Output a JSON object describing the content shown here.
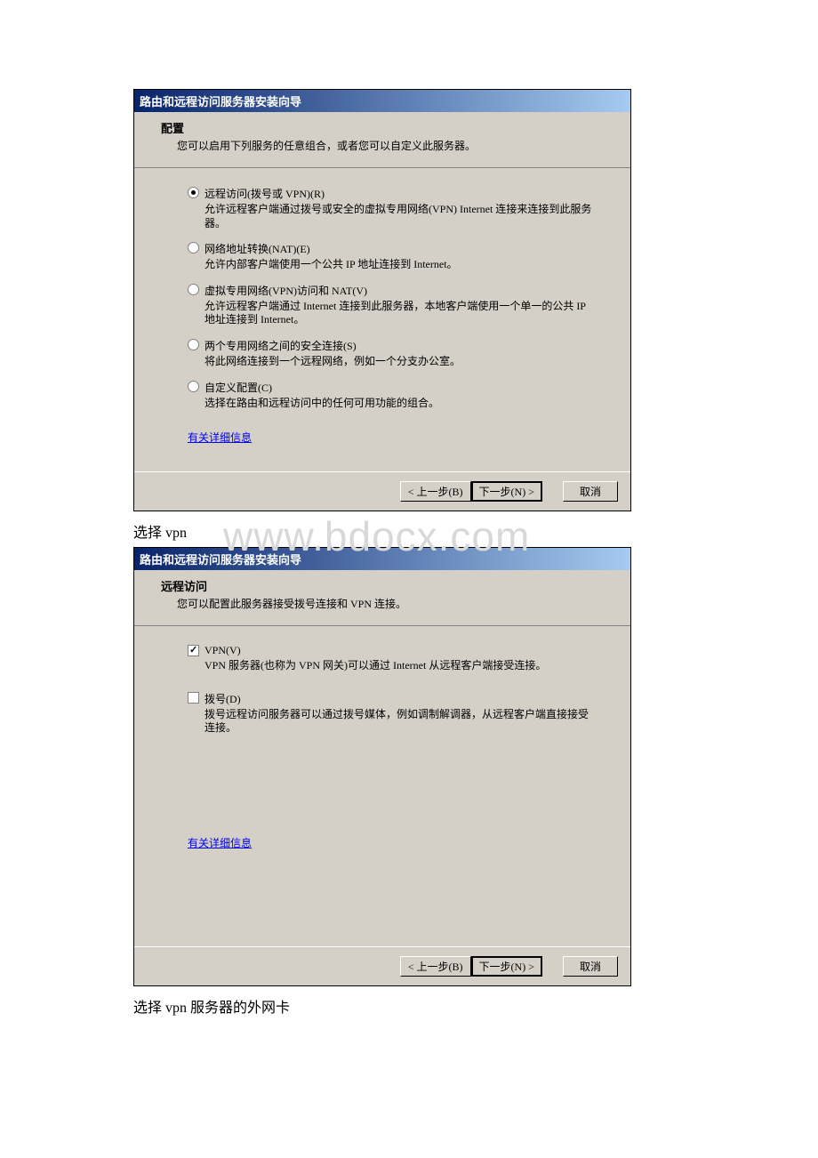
{
  "watermark": "www.bdocx.com",
  "dialog1": {
    "title": "路由和远程访问服务器安装向导",
    "header_title": "配置",
    "header_desc": "您可以启用下列服务的任意组合，或者您可以自定义此服务器。",
    "options": [
      {
        "label": "远程访问(拨号或 VPN)(R)",
        "desc": "允许远程客户端通过拨号或安全的虚拟专用网络(VPN) Internet 连接来连接到此服务器。",
        "selected": true
      },
      {
        "label": "网络地址转换(NAT)(E)",
        "desc": "允许内部客户端使用一个公共 IP 地址连接到 Internet。",
        "selected": false
      },
      {
        "label": "虚拟专用网络(VPN)访问和 NAT(V)",
        "desc": "允许远程客户端通过 Internet 连接到此服务器，本地客户端使用一个单一的公共 IP 地址连接到 Internet。",
        "selected": false
      },
      {
        "label": "两个专用网络之间的安全连接(S)",
        "desc": "将此网络连接到一个远程网络，例如一个分支办公室。",
        "selected": false
      },
      {
        "label": "自定义配置(C)",
        "desc": "选择在路由和远程访问中的任何可用功能的组合。",
        "selected": false
      }
    ],
    "more_info": "有关详细信息",
    "back": "< 上一步(B)",
    "next": "下一步(N) >",
    "cancel": "取消"
  },
  "caption1": "选择 vpn",
  "dialog2": {
    "title": "路由和远程访问服务器安装向导",
    "header_title": "远程访问",
    "header_desc": "您可以配置此服务器接受拨号连接和 VPN 连接。",
    "options": [
      {
        "label": "VPN(V)",
        "desc": "VPN 服务器(也称为 VPN 网关)可以通过 Internet 从远程客户端接受连接。",
        "checked": true
      },
      {
        "label": "拨号(D)",
        "desc": "拨号远程访问服务器可以通过拨号媒体，例如调制解调器，从远程客户端直接接受连接。",
        "checked": false
      }
    ],
    "more_info": "有关详细信息",
    "back": "< 上一步(B)",
    "next": "下一步(N) >",
    "cancel": "取消"
  },
  "caption2": "选择 vpn 服务器的外网卡"
}
